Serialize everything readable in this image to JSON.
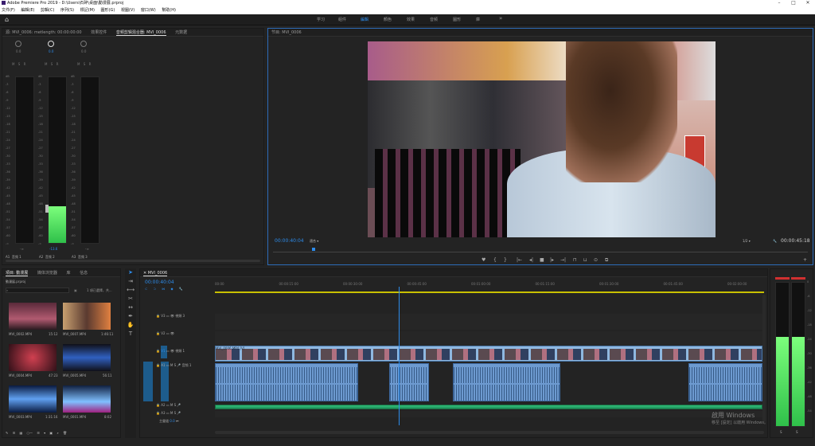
{
  "window": {
    "title": "Adobe Premiere Pro 2019 - D:\\Users\\石碎\\桌面\\動漫展.prproj",
    "controls": [
      "–",
      "□",
      "✕"
    ]
  },
  "menu": [
    "文件(F)",
    "編輯(E)",
    "剪輯(C)",
    "序列(S)",
    "標記(M)",
    "圖形(G)",
    "視圖(V)",
    "窗口(W)",
    "幫助(H)"
  ],
  "workspaces": {
    "items": [
      "学习",
      "組件",
      "編輯",
      "顏色",
      "效果",
      "音频",
      "圖形",
      "庫"
    ],
    "active": "編輯",
    "more": "»"
  },
  "mixer": {
    "tabs": [
      "源: MVI_0006: metlength: 00:00:00:00",
      "效果控件",
      "音频剪辑混合器: MVI_0006",
      "元数据"
    ],
    "channels": [
      {
        "id": "A1",
        "name": "音频 1",
        "pan": "0.0",
        "peak": "-∞",
        "level": 0.0
      },
      {
        "id": "A2",
        "name": "音频 2",
        "pan": "0.0",
        "peak": "-13.6",
        "level": 0.22
      },
      {
        "id": "A3",
        "name": "音频 3",
        "pan": "0.0",
        "peak": "-∞",
        "level": 0.0
      }
    ],
    "scale": [
      "dB",
      "-3",
      "-6",
      "-9",
      "-12",
      "-15",
      "-18",
      "-21",
      "-24",
      "-27",
      "-30",
      "-33",
      "-36",
      "-39",
      "-42",
      "-45",
      "-48",
      "-51",
      "-54",
      "-57",
      "-60",
      "-∞"
    ],
    "buttons": [
      "M",
      "S",
      "R"
    ]
  },
  "program": {
    "title": "节目: MVI_0006",
    "timecode": "00:00:40:04",
    "fit": "適合",
    "quality": "1/2",
    "duration": "00:00:45:18"
  },
  "project": {
    "tabs": [
      "項目: 動漫展",
      "媒体浏览器",
      "库",
      "信息"
    ],
    "name": "動漫展.prproj",
    "selection": "1 項已選擇，共...",
    "search_placeholder": "",
    "items": [
      {
        "name": "MVI_0002.MP4",
        "duration": "15:12"
      },
      {
        "name": "MVI_0007.MP4",
        "duration": "1:46:11"
      },
      {
        "name": "MVI_0004.MP4",
        "duration": "47:23"
      },
      {
        "name": "MVI_0005.MP4",
        "duration": "56:11"
      },
      {
        "name": "MVI_0003.MP4",
        "duration": "1:31:16"
      },
      {
        "name": "MVI_0001.MP4",
        "duration": "8:02"
      }
    ]
  },
  "timeline": {
    "tab": "MVI_0006",
    "timecode": "00:00:40:04",
    "ruler": [
      "00:00",
      "00:00:15:00",
      "00:00:30:00",
      "00:00:45:00",
      "00:01:00:00",
      "00:01:15:00",
      "00:01:30:00",
      "00:01:45:00",
      "00:02:00:00"
    ],
    "tracks_video": [
      "V3",
      "V2",
      "V1"
    ],
    "tracks_audio": [
      "A1",
      "A2",
      "A3"
    ],
    "track_names": {
      "V3": "視頻 3",
      "V1": "視頻 1",
      "A1": "音频 1",
      "master": "主聲道",
      "master_value": "0.0"
    },
    "clip_label": "MVI_0006.MP4 [V]",
    "playhead_fraction": 0.335
  },
  "vu": {
    "scale": [
      "0",
      "-6",
      "-12",
      "-18",
      "-24",
      "-30",
      "-36",
      "-42",
      "-48",
      "-54"
    ],
    "labels": [
      "S",
      "S"
    ],
    "level": 0.62
  },
  "watermark": {
    "line1": "啟用 Windows",
    "line2": "移至 [設定] 以啟用 Windows。"
  }
}
